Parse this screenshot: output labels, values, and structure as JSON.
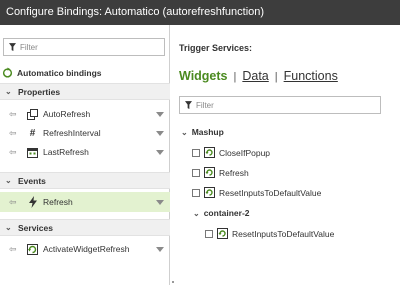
{
  "window": {
    "title": "Configure Bindings: Automatico (autorefreshfunction)"
  },
  "left": {
    "filter_placeholder": "Filter",
    "bindings_title": "Automatico bindings",
    "sections": [
      {
        "label": "Properties"
      },
      {
        "label": "Events"
      },
      {
        "label": "Services"
      }
    ],
    "properties": [
      {
        "label": "AutoRefresh",
        "icon": "widget-icon"
      },
      {
        "label": "RefreshInterval",
        "icon": "hash-icon"
      },
      {
        "label": "LastRefresh",
        "icon": "calendar-icon"
      }
    ],
    "events": [
      {
        "label": "Refresh",
        "icon": "lightning-icon",
        "selected": true
      }
    ],
    "services": [
      {
        "label": "ActivateWidgetRefresh",
        "icon": "service-icon"
      }
    ]
  },
  "right": {
    "title": "Trigger Services:",
    "tabs": [
      {
        "label": "Widgets",
        "active": true
      },
      {
        "label": "Data",
        "active": false
      },
      {
        "label": "Functions",
        "active": false
      }
    ],
    "tab_separator": "|",
    "filter_placeholder": "Filter",
    "tree": {
      "mashup_label": "Mashup",
      "mashup_items": [
        "CloseIfPopup",
        "Refresh",
        "ResetInputsToDefaultValue"
      ],
      "container_label": "container-2",
      "container_items": [
        "ResetInputsToDefaultValue"
      ]
    }
  },
  "colors": {
    "titlebar": "#3d3d3d",
    "accent_green": "#4a8a1f",
    "selected_row": "#e3f2d0"
  }
}
